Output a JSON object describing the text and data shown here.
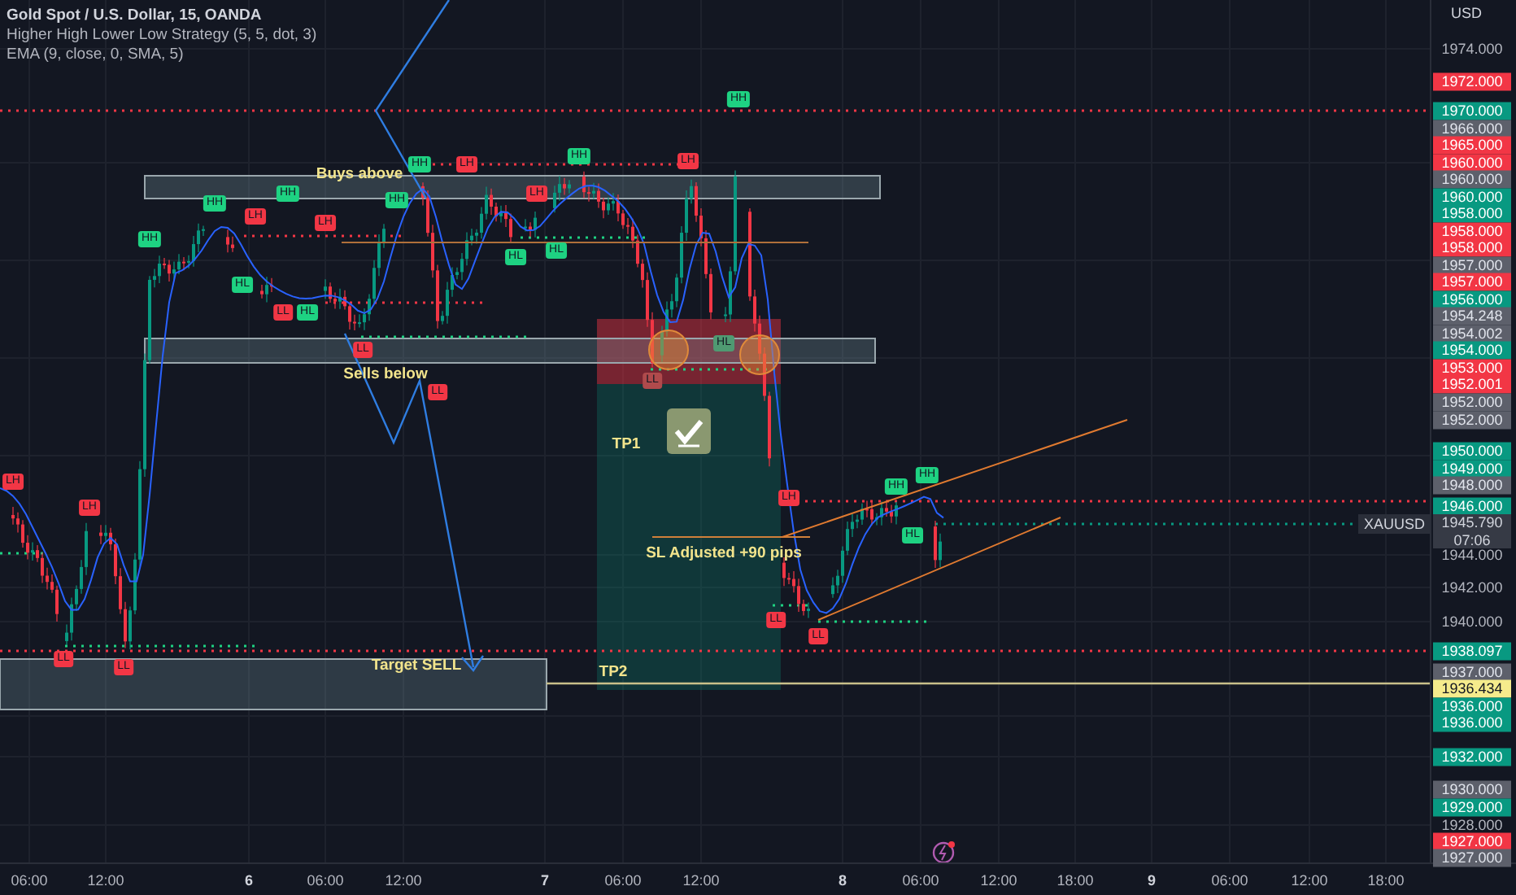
{
  "header": {
    "symbol": "Gold Spot / U.S. Dollar, 15, OANDA",
    "indicators": [
      "Higher High Lower Low Strategy (5, 5, dot, 3)",
      "EMA (9, close, 0, SMA, 5)"
    ]
  },
  "chart": {
    "swing_labels": [
      {
        "label": "LH",
        "color": "#f23645"
      },
      {
        "label": "LH",
        "color": "#f23645"
      },
      {
        "label": "LL",
        "color": "#f23645"
      },
      {
        "label": "LL",
        "color": "#f23645"
      },
      {
        "label": "HH",
        "color": "#1ed282"
      },
      {
        "label": "HH",
        "color": "#1ed282"
      },
      {
        "label": "LH",
        "color": "#f23645"
      },
      {
        "label": "HL",
        "color": "#1ed282"
      },
      {
        "label": "LL",
        "color": "#f23645"
      },
      {
        "label": "HH",
        "color": "#1ed282"
      },
      {
        "label": "HL",
        "color": "#1ed282"
      },
      {
        "label": "LH",
        "color": "#f23645"
      },
      {
        "label": "HH",
        "color": "#1ed282"
      },
      {
        "label": "LL",
        "color": "#f23645"
      },
      {
        "label": "HH",
        "color": "#1ed282"
      },
      {
        "label": "LL",
        "color": "#f23645"
      },
      {
        "label": "LH",
        "color": "#f23645"
      },
      {
        "label": "HL",
        "color": "#1ed282"
      },
      {
        "label": "LH",
        "color": "#f23645"
      },
      {
        "label": "HL",
        "color": "#1ed282"
      },
      {
        "label": "HH",
        "color": "#1ed282"
      },
      {
        "label": "LL",
        "color": "#b04a4c"
      },
      {
        "label": "LH",
        "color": "#f23645"
      },
      {
        "label": "HL",
        "color": "#4f9a72"
      },
      {
        "label": "HH",
        "color": "#1ed282"
      },
      {
        "label": "LH",
        "color": "#f23645"
      },
      {
        "label": "LL",
        "color": "#f23645"
      },
      {
        "label": "LL",
        "color": "#f23645"
      },
      {
        "label": "HH",
        "color": "#1ed282"
      },
      {
        "label": "HL",
        "color": "#1ed282"
      },
      {
        "label": "HH",
        "color": "#1ed282"
      }
    ],
    "annotations": [
      {
        "text": "Buys above"
      },
      {
        "text": "Sells below"
      },
      {
        "text": "TP1"
      },
      {
        "text": "SL Adjusted +90 pips"
      },
      {
        "text": "Target SELL"
      },
      {
        "text": "TP2"
      }
    ],
    "symbol_tag": "XAUUSD"
  },
  "price_axis": {
    "currency": "USD",
    "labels": [
      {
        "text": "1974.000",
        "kind": "plain"
      },
      {
        "text": "1972.000",
        "kind": "red"
      },
      {
        "text": "1970.000",
        "kind": "green"
      },
      {
        "text": "1966.000",
        "kind": "gray"
      },
      {
        "text": "1965.000",
        "kind": "red"
      },
      {
        "text": "1960.000",
        "kind": "red"
      },
      {
        "text": "1960.000",
        "kind": "gray"
      },
      {
        "text": "1960.000",
        "kind": "green"
      },
      {
        "text": "1958.000",
        "kind": "green"
      },
      {
        "text": "1958.000",
        "kind": "red"
      },
      {
        "text": "1958.000",
        "kind": "red"
      },
      {
        "text": "1957.000",
        "kind": "gray"
      },
      {
        "text": "1957.000",
        "kind": "red"
      },
      {
        "text": "1956.000",
        "kind": "green"
      },
      {
        "text": "1954.248",
        "kind": "gray"
      },
      {
        "text": "1954.002",
        "kind": "gray"
      },
      {
        "text": "1954.000",
        "kind": "green"
      },
      {
        "text": "1953.000",
        "kind": "red"
      },
      {
        "text": "1952.001",
        "kind": "red"
      },
      {
        "text": "1952.000",
        "kind": "gray"
      },
      {
        "text": "1952.000",
        "kind": "gray"
      },
      {
        "text": "1950.000",
        "kind": "green"
      },
      {
        "text": "1949.000",
        "kind": "green"
      },
      {
        "text": "1948.000",
        "kind": "gray"
      },
      {
        "text": "1946.000",
        "kind": "green"
      },
      {
        "text": "1945.790",
        "kind": "current",
        "countdown": "07:06"
      },
      {
        "text": "1944.000",
        "kind": "plain"
      },
      {
        "text": "1942.000",
        "kind": "plain"
      },
      {
        "text": "1940.000",
        "kind": "plain"
      },
      {
        "text": "1938.097",
        "kind": "green"
      },
      {
        "text": "1937.000",
        "kind": "gray"
      },
      {
        "text": "1936.434",
        "kind": "yellow"
      },
      {
        "text": "1936.000",
        "kind": "green"
      },
      {
        "text": "1936.000",
        "kind": "green"
      },
      {
        "text": "1932.000",
        "kind": "green"
      },
      {
        "text": "1930.000",
        "kind": "gray"
      },
      {
        "text": "1929.000",
        "kind": "green"
      },
      {
        "text": "1928.000",
        "kind": "plain"
      },
      {
        "text": "1927.000",
        "kind": "red"
      },
      {
        "text": "1927.000",
        "kind": "gray"
      }
    ]
  },
  "time_axis": [
    {
      "text": "06:00",
      "kind": "time"
    },
    {
      "text": "12:00",
      "kind": "time"
    },
    {
      "text": "6",
      "kind": "day"
    },
    {
      "text": "06:00",
      "kind": "time"
    },
    {
      "text": "12:00",
      "kind": "time"
    },
    {
      "text": "7",
      "kind": "day"
    },
    {
      "text": "06:00",
      "kind": "time"
    },
    {
      "text": "12:00",
      "kind": "time"
    },
    {
      "text": "8",
      "kind": "day"
    },
    {
      "text": "06:00",
      "kind": "time"
    },
    {
      "text": "12:00",
      "kind": "time"
    },
    {
      "text": "18:00",
      "kind": "time"
    },
    {
      "text": "9",
      "kind": "day"
    },
    {
      "text": "06:00",
      "kind": "time"
    },
    {
      "text": "12:00",
      "kind": "time"
    },
    {
      "text": "18:00",
      "kind": "time"
    }
  ]
}
